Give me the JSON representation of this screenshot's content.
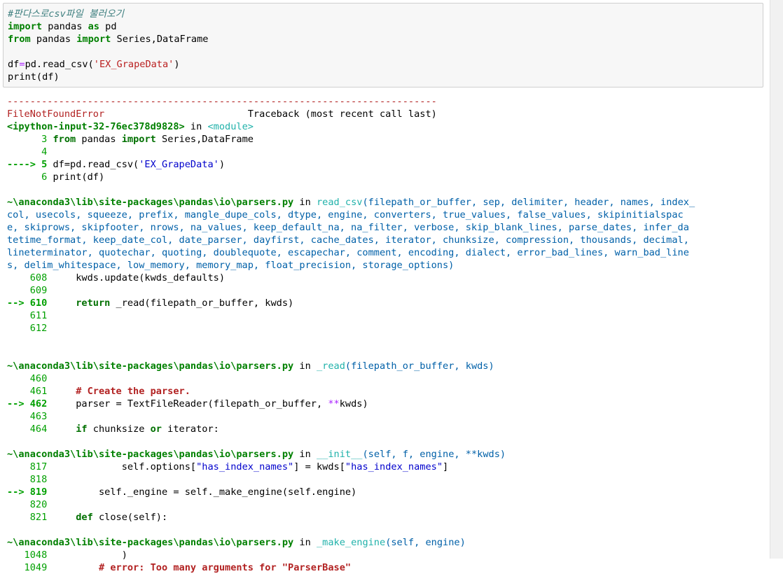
{
  "input": {
    "comment": "#판다스로csv파일 불러오기",
    "import_kw": "import",
    "pandas_mod": " pandas ",
    "as_kw": "as",
    "pd_alias": " pd",
    "from_kw": "from",
    "from_mod": " pandas ",
    "import_kw2": "import",
    "import_names": " Series,DataFrame",
    "df_name": "df",
    "eq": "=",
    "read_call": "pd.read_csv(",
    "csv_arg": "'EX_GrapeData'",
    "close_paren": ")",
    "print_line": "print(df)"
  },
  "output": {
    "separator": "---------------------------------------------------------------------------",
    "error_name": "FileNotFoundError",
    "traceback_pad": "                         ",
    "traceback_label": "Traceback (most recent call last)",
    "ipython_input": "<ipython-input-32-76ec378d9828>",
    "in_word": " in ",
    "module_word": "<module>",
    "f1": {
      "l3_num": "      3 ",
      "l3_from": "from",
      "l3_mod": " pandas ",
      "l3_import": "import",
      "l3_names": " Series,DataFrame",
      "l4_num": "      4",
      "l5_arrow": "----> 5 ",
      "l5_code": "df=pd.read_csv(",
      "l5_str": "'EX_GrapeData'",
      "l5_close": ")",
      "l6_num": "      6 ",
      "l6_code": "print(df)"
    },
    "f2": {
      "path": "~\\anaconda3\\lib\\site-packages\\pandas\\io\\parsers.py",
      "in_word": " in ",
      "func": "read_csv",
      "sig": [
        "(filepath_or_buffer, sep, delimiter, header, names, index_",
        "col, usecols, squeeze, prefix, mangle_dupe_cols, dtype, engine, converters, true_values, false_values, skipinitialspac",
        "e, skiprows, skipfooter, nrows, na_values, keep_default_na, na_filter, verbose, skip_blank_lines, parse_dates, infer_da",
        "tetime_format, keep_date_col, date_parser, dayfirst, cache_dates, iterator, chunksize, compression, thousands, decimal,",
        "lineterminator, quotechar, quoting, doublequote, escapechar, comment, encoding, dialect, error_bad_lines, warn_bad_line",
        "s, delim_whitespace, low_memory, memory_map, float_precision, storage_options)"
      ],
      "l608_num": "    608 ",
      "l608_code": "    kwds.update(kwds_defaults)",
      "l609_num": "    609",
      "l610_arrow": "--> 610 ",
      "l610_ret": "    return",
      "l610_code": " _read(filepath_or_buffer, kwds)",
      "l611_num": "    611",
      "l612_num": "    612"
    },
    "f3": {
      "path": "~\\anaconda3\\lib\\site-packages\\pandas\\io\\parsers.py",
      "in_word": " in ",
      "func": "_read",
      "sig": "(filepath_or_buffer, kwds)",
      "l460_num": "    460",
      "l461_num": "    461 ",
      "l461_cmt": "    # Create the parser.",
      "l462_arrow": "--> 462 ",
      "l462_code": "    parser = TextFileReader(filepath_or_buffer, ",
      "l462_op": "**",
      "l462_tail": "kwds)",
      "l463_num": "    463",
      "l464_num": "    464 ",
      "l464_if": "    if",
      "l464_mid": " chunksize ",
      "l464_or": "or",
      "l464_tail": " iterator:"
    },
    "f4": {
      "path": "~\\anaconda3\\lib\\site-packages\\pandas\\io\\parsers.py",
      "in_word": " in ",
      "func": "__init__",
      "sig": "(self, f, engine, **kwds)",
      "l817_num": "    817 ",
      "l817_code": "            self.options[",
      "l817_s1": "\"has_index_names\"",
      "l817_mid": "] = kwds[",
      "l817_s2": "\"has_index_names\"",
      "l817_end": "]",
      "l818_num": "    818",
      "l819_arrow": "--> 819 ",
      "l819_code": "        self._engine = self._make_engine(self.engine)",
      "l820_num": "    820",
      "l821_num": "    821 ",
      "l821_def": "    def",
      "l821_code": " close(self):"
    },
    "f5": {
      "path": "~\\anaconda3\\lib\\site-packages\\pandas\\io\\parsers.py",
      "in_word": " in ",
      "func": "_make_engine",
      "sig": "(self, engine)",
      "l1048_num": "   1048 ",
      "l1048_code": "            )",
      "l1049_num": "   1049 ",
      "l1049_cmt": "        # error: Too many arguments for \"ParserBase\""
    }
  }
}
